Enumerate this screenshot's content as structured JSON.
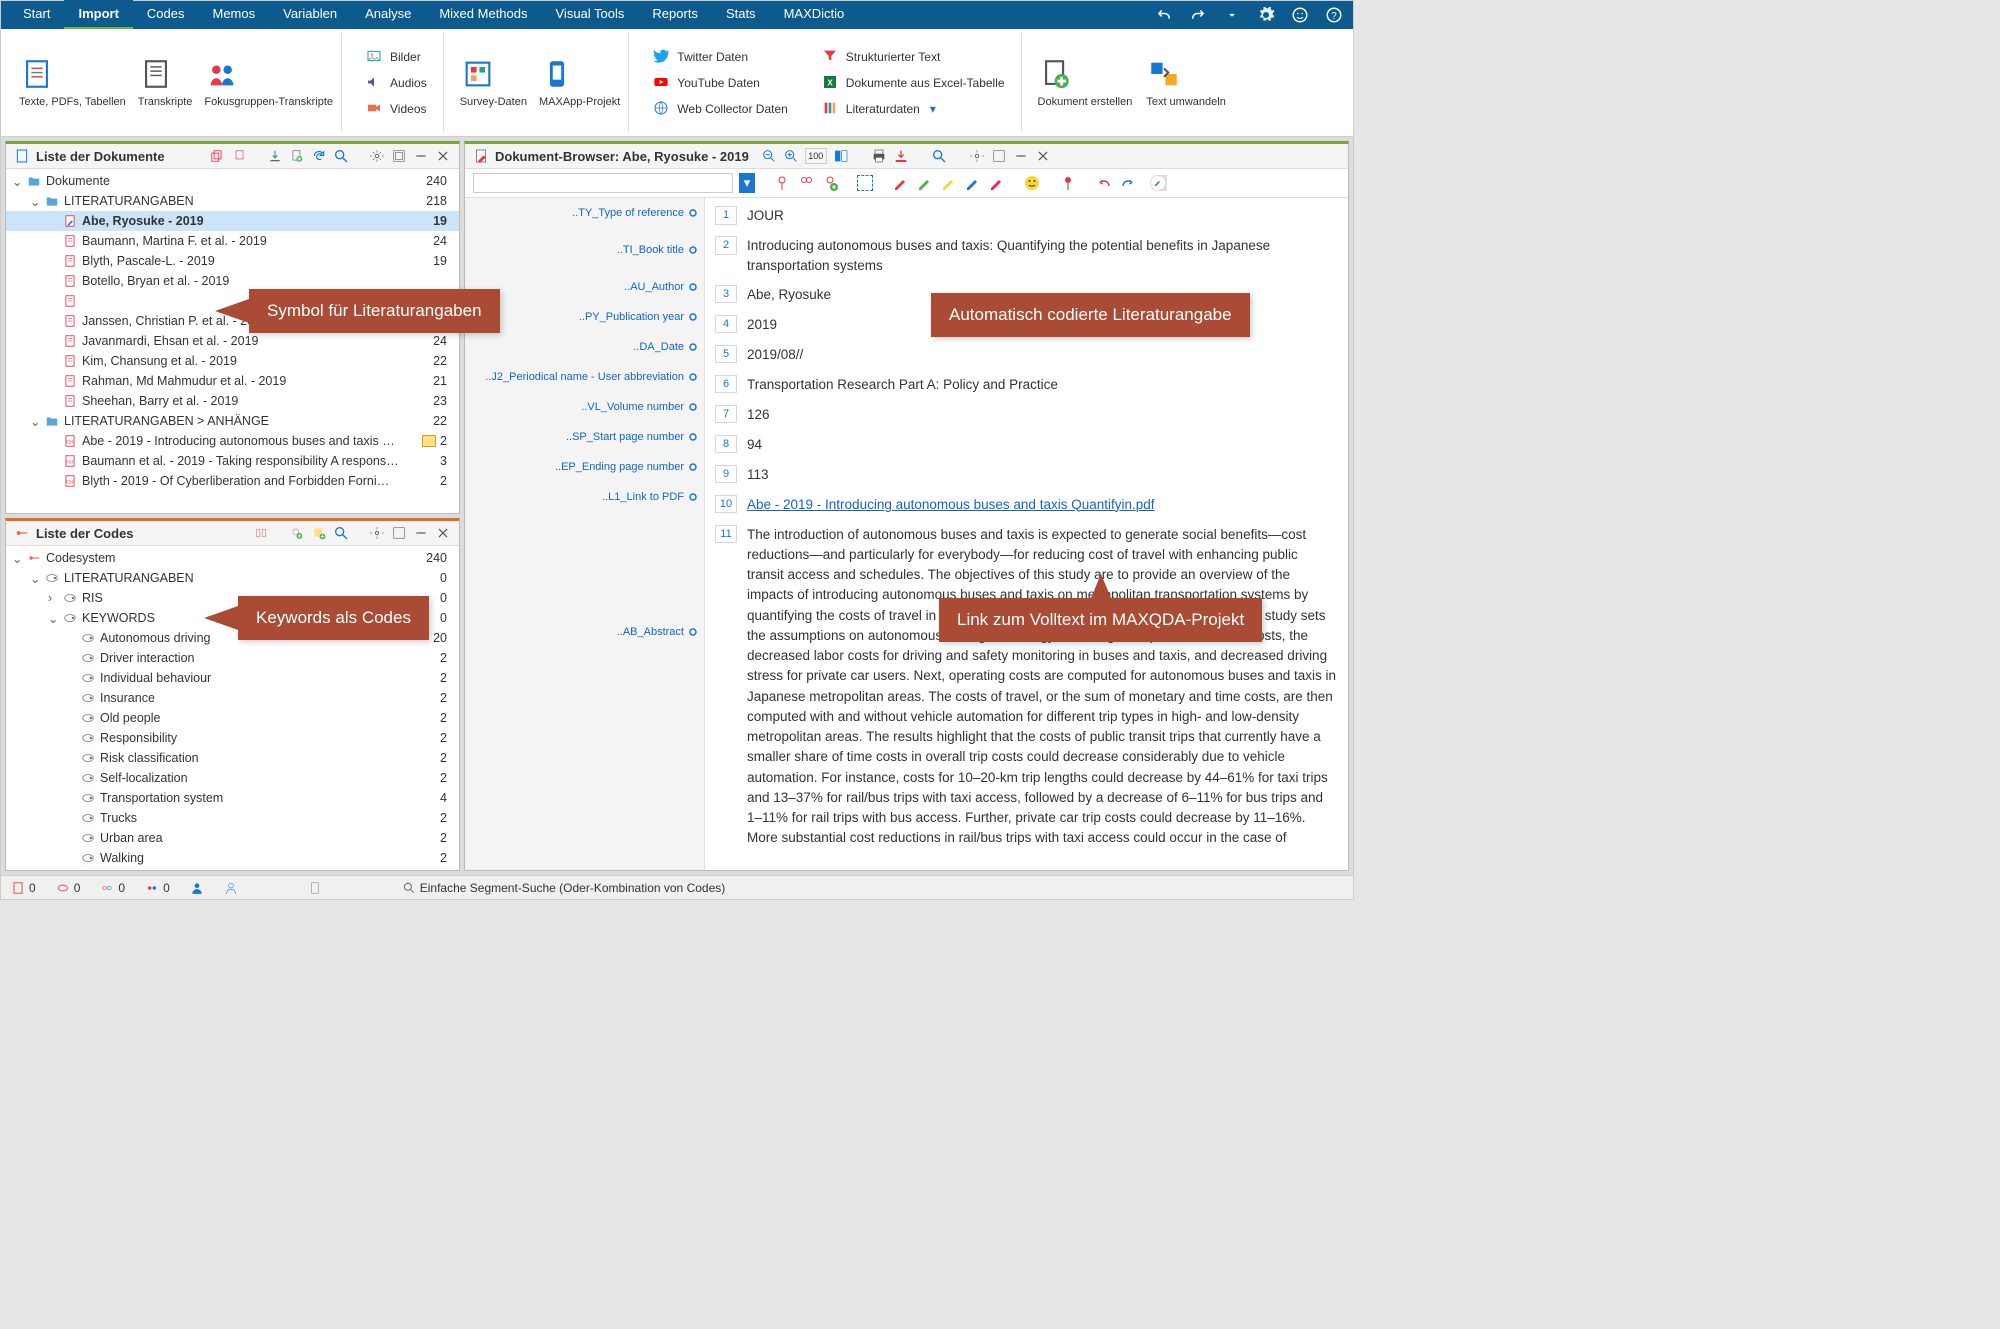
{
  "menu": {
    "items": [
      "Start",
      "Import",
      "Codes",
      "Memos",
      "Variablen",
      "Analyse",
      "Mixed Methods",
      "Visual Tools",
      "Reports",
      "Stats",
      "MAXDictio"
    ],
    "active": 1
  },
  "ribbon": {
    "g1": [
      {
        "label": "Texte, PDFs, Tabellen"
      },
      {
        "label": "Transkripte"
      },
      {
        "label": "Fokusgruppen-Transkripte"
      }
    ],
    "g2": [
      "Bilder",
      "Audios",
      "Videos"
    ],
    "g3": [
      {
        "label": "Survey-Daten"
      },
      {
        "label": "MAXApp-Projekt"
      }
    ],
    "g4_col1": [
      "Twitter Daten",
      "YouTube Daten",
      "Web Collector Daten"
    ],
    "g4_col2": [
      "Strukturierter Text",
      "Dokumente aus Excel-Tabelle",
      "Literaturdaten"
    ],
    "g5": [
      {
        "label": "Dokument erstellen"
      },
      {
        "label": "Text umwandeln"
      }
    ]
  },
  "docs_panel": {
    "title": "Liste der Dokumente",
    "rows": [
      {
        "d": 0,
        "exp": "v",
        "icon": "folder",
        "label": "Dokumente",
        "count": "240"
      },
      {
        "d": 1,
        "exp": "v",
        "icon": "folder",
        "label": "LITERATURANGABEN",
        "count": "218"
      },
      {
        "d": 2,
        "icon": "doc-edit",
        "label": "Abe, Ryosuke - 2019",
        "count": "19",
        "sel": true
      },
      {
        "d": 2,
        "icon": "doc",
        "label": "Baumann, Martina F. et al. - 2019",
        "count": "24"
      },
      {
        "d": 2,
        "icon": "doc",
        "label": "Blyth, Pascale-L. - 2019",
        "count": "19"
      },
      {
        "d": 2,
        "icon": "doc",
        "label": "Botello, Bryan et al. - 2019",
        "count": ""
      },
      {
        "d": 2,
        "icon": "doc",
        "label": "",
        "count": ""
      },
      {
        "d": 2,
        "icon": "doc",
        "label": "Janssen, Christian P. et al. - 2019",
        "count": ""
      },
      {
        "d": 2,
        "icon": "doc",
        "label": "Javanmardi, Ehsan et al. - 2019",
        "count": "24"
      },
      {
        "d": 2,
        "icon": "doc",
        "label": "Kim, Chansung et al. - 2019",
        "count": "22"
      },
      {
        "d": 2,
        "icon": "doc",
        "label": "Rahman, Md Mahmudur et al. - 2019",
        "count": "21"
      },
      {
        "d": 2,
        "icon": "doc",
        "label": "Sheehan, Barry et al. - 2019",
        "count": "23"
      },
      {
        "d": 1,
        "exp": "v",
        "icon": "folder",
        "label": "LITERATURANGABEN > ANHÄNGE",
        "count": "22"
      },
      {
        "d": 2,
        "icon": "pdf",
        "label": "Abe - 2019 - Introducing autonomous buses and taxis …",
        "count": "2",
        "memo": true
      },
      {
        "d": 2,
        "icon": "pdf",
        "label": "Baumann et al. - 2019 - Taking responsibility A respons…",
        "count": "3"
      },
      {
        "d": 2,
        "icon": "pdf",
        "label": "Blyth - 2019 - Of Cyberliberation and Forbidden Forni…",
        "count": "2"
      }
    ]
  },
  "codes_panel": {
    "title": "Liste der Codes",
    "rows": [
      {
        "d": 0,
        "exp": "v",
        "icon": "codesys",
        "label": "Codesystem",
        "count": "240"
      },
      {
        "d": 1,
        "exp": "v",
        "icon": "code",
        "label": "LITERATURANGABEN",
        "count": "0"
      },
      {
        "d": 2,
        "exp": ">",
        "icon": "code",
        "label": "RIS",
        "count": "0"
      },
      {
        "d": 2,
        "exp": "v",
        "icon": "code",
        "label": "KEYWORDS",
        "count": "0"
      },
      {
        "d": 3,
        "icon": "code",
        "label": "Autonomous driving",
        "count": "20"
      },
      {
        "d": 3,
        "icon": "code",
        "label": "Driver interaction",
        "count": "2"
      },
      {
        "d": 3,
        "icon": "code",
        "label": "Individual behaviour",
        "count": "2"
      },
      {
        "d": 3,
        "icon": "code",
        "label": "Insurance",
        "count": "2"
      },
      {
        "d": 3,
        "icon": "code",
        "label": "Old people",
        "count": "2"
      },
      {
        "d": 3,
        "icon": "code",
        "label": "Responsibility",
        "count": "2"
      },
      {
        "d": 3,
        "icon": "code",
        "label": "Risk classification",
        "count": "2"
      },
      {
        "d": 3,
        "icon": "code",
        "label": "Self-localization",
        "count": "2"
      },
      {
        "d": 3,
        "icon": "code",
        "label": "Transportation system",
        "count": "4"
      },
      {
        "d": 3,
        "icon": "code",
        "label": "Trucks",
        "count": "2"
      },
      {
        "d": 3,
        "icon": "code",
        "label": "Urban area",
        "count": "2"
      },
      {
        "d": 3,
        "icon": "code",
        "label": "Walking",
        "count": "2"
      }
    ]
  },
  "browser": {
    "title": "Dokument-Browser: Abe, Ryosuke - 2019",
    "fields": [
      {
        "tag": "..TY_Type of reference",
        "ln": "1",
        "val": "JOUR"
      },
      {
        "tag": "..TI_Book title",
        "ln": "2",
        "val": "Introducing autonomous buses and taxis: Quantifying the potential benefits in Japanese transportation systems"
      },
      {
        "tag": "..AU_Author",
        "ln": "3",
        "val": "Abe, Ryosuke"
      },
      {
        "tag": "..PY_Publication year",
        "ln": "4",
        "val": "2019"
      },
      {
        "tag": "..DA_Date",
        "ln": "5",
        "val": "2019/08//"
      },
      {
        "tag": "..J2_Periodical name - User abbreviation",
        "ln": "6",
        "val": "Transportation Research Part A: Policy and Practice"
      },
      {
        "tag": "..VL_Volume number",
        "ln": "7",
        "val": "126"
      },
      {
        "tag": "..SP_Start page number",
        "ln": "8",
        "val": "94"
      },
      {
        "tag": "..EP_Ending page number",
        "ln": "9",
        "val": "113"
      },
      {
        "tag": "..L1_Link to PDF",
        "ln": "10",
        "link": "Abe - 2019 - Introducing autonomous buses and taxis Quantifyin.pdf"
      },
      {
        "tag": "..AB_Abstract",
        "ln": "11",
        "val": "The introduction of autonomous buses and taxis is expected to generate social benefits—cost reductions—and particularly for everybody—for reducing cost of travel with enhancing public transit access and schedules. The objectives of this study are to provide an overview of the impacts of introducing autonomous buses and taxis on metropolitan transportation systems by quantifying the costs of travel in Japan, and to discuss the potential benefits. First, this study sets the assumptions on autonomous driving technology, including its impacts on vehicle costs, the decreased labor costs for driving and safety monitoring in buses and taxis, and decreased driving stress for private car users. Next, operating costs are computed for autonomous buses and taxis in Japanese metropolitan areas. The costs of travel, or the sum of monetary and time costs, are then computed with and without vehicle automation for different trip types in high- and low-density metropolitan areas. The results highlight that the costs of public transit trips that currently have a smaller share of time costs in overall trip costs could decrease considerably due to vehicle automation. For instance, costs for 10–20-km trip lengths could decrease by 44–61% for taxi trips and 13–37% for rail/bus trips with taxi access, followed by a decrease of 6–11% for bus trips and 1–11% for rail trips with bus access. Further, private car trip costs could decrease by 11–16%. More substantial cost reductions in rail/bus trips with taxi access could occur in the case of"
      }
    ]
  },
  "callouts": {
    "c1": "Symbol für Literaturangaben",
    "c2": "Keywords als Codes",
    "c3": "Automatisch codierte Literaturangabe",
    "c4": "Link zum Volltext im MAXQDA-Projekt"
  },
  "statusbar": {
    "items": [
      "0",
      "0",
      "0",
      "0"
    ],
    "search": "Einfache Segment-Suche (Oder-Kombination von Codes)"
  }
}
